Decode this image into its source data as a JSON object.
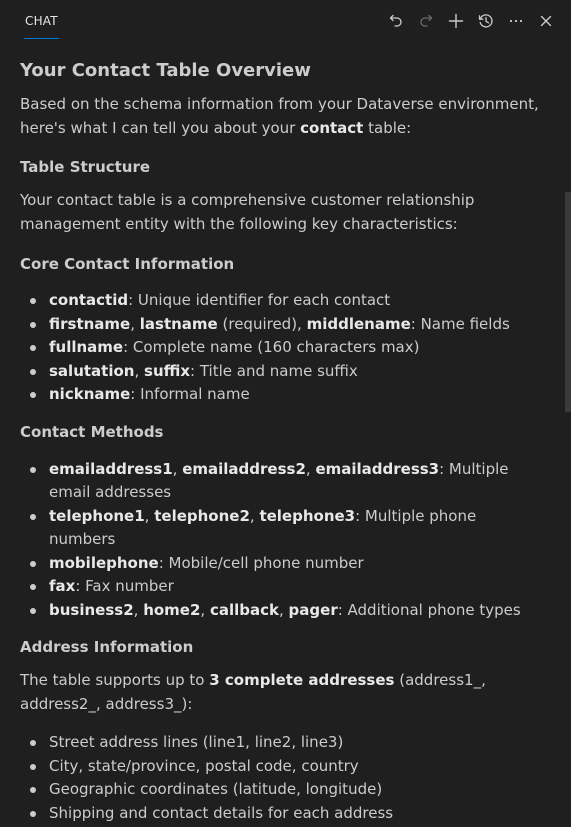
{
  "header": {
    "tab_label": "CHAT",
    "actions": [
      {
        "icon": "undo-icon",
        "enabled": true
      },
      {
        "icon": "redo-icon",
        "enabled": false
      },
      {
        "icon": "plus-icon",
        "enabled": true
      },
      {
        "icon": "history-icon",
        "enabled": true
      },
      {
        "icon": "more-icon",
        "enabled": true
      },
      {
        "icon": "close-icon",
        "enabled": true
      }
    ]
  },
  "message": {
    "title": "Your Contact Table Overview",
    "intro": [
      {
        "t": "Based on the schema information from your Dataverse environment, here's what I can tell you about your "
      },
      {
        "t": "contact",
        "b": true
      },
      {
        "t": " table:"
      }
    ],
    "section_structure_heading": "Table Structure",
    "structure_text": [
      {
        "t": "Your contact table is a comprehensive customer relationship management entity with the following key characteristics:"
      }
    ],
    "section_core_heading": "Core Contact Information",
    "core_items": [
      [
        {
          "t": "contactid",
          "b": true
        },
        {
          "t": ": Unique identifier for each contact"
        }
      ],
      [
        {
          "t": "firstname",
          "b": true
        },
        {
          "t": ", "
        },
        {
          "t": "lastname",
          "b": true
        },
        {
          "t": " (required), "
        },
        {
          "t": "middlename",
          "b": true
        },
        {
          "t": ": Name fields"
        }
      ],
      [
        {
          "t": "fullname",
          "b": true
        },
        {
          "t": ": Complete name (160 characters max)"
        }
      ],
      [
        {
          "t": "salutation",
          "b": true
        },
        {
          "t": ", "
        },
        {
          "t": "suffix",
          "b": true
        },
        {
          "t": ": Title and name suffix"
        }
      ],
      [
        {
          "t": "nickname",
          "b": true
        },
        {
          "t": ": Informal name"
        }
      ]
    ],
    "section_methods_heading": "Contact Methods",
    "method_items": [
      [
        {
          "t": "emailaddress1",
          "b": true
        },
        {
          "t": ", "
        },
        {
          "t": "emailaddress2",
          "b": true
        },
        {
          "t": ", "
        },
        {
          "t": "emailaddress3",
          "b": true
        },
        {
          "t": ": Multiple email addresses"
        }
      ],
      [
        {
          "t": "telephone1",
          "b": true
        },
        {
          "t": ", "
        },
        {
          "t": "telephone2",
          "b": true
        },
        {
          "t": ", "
        },
        {
          "t": "telephone3",
          "b": true
        },
        {
          "t": ": Multiple phone numbers"
        }
      ],
      [
        {
          "t": "mobilephone",
          "b": true
        },
        {
          "t": ": Mobile/cell phone number"
        }
      ],
      [
        {
          "t": "fax",
          "b": true
        },
        {
          "t": ": Fax number"
        }
      ],
      [
        {
          "t": "business2",
          "b": true
        },
        {
          "t": ", "
        },
        {
          "t": "home2",
          "b": true
        },
        {
          "t": ", "
        },
        {
          "t": "callback",
          "b": true
        },
        {
          "t": ", "
        },
        {
          "t": "pager",
          "b": true
        },
        {
          "t": ": Additional phone types"
        }
      ]
    ],
    "section_address_heading": "Address Information",
    "address_text": [
      {
        "t": "The table supports up to "
      },
      {
        "t": "3 complete addresses",
        "b": true
      },
      {
        "t": " (address1_, address2_, address3_):"
      }
    ],
    "address_items": [
      [
        {
          "t": "Street address lines (line1, line2, line3)"
        }
      ],
      [
        {
          "t": "City, state/province, postal code, country"
        }
      ],
      [
        {
          "t": "Geographic coordinates (latitude, longitude)"
        }
      ],
      [
        {
          "t": "Shipping and contact details for each address"
        }
      ]
    ]
  }
}
